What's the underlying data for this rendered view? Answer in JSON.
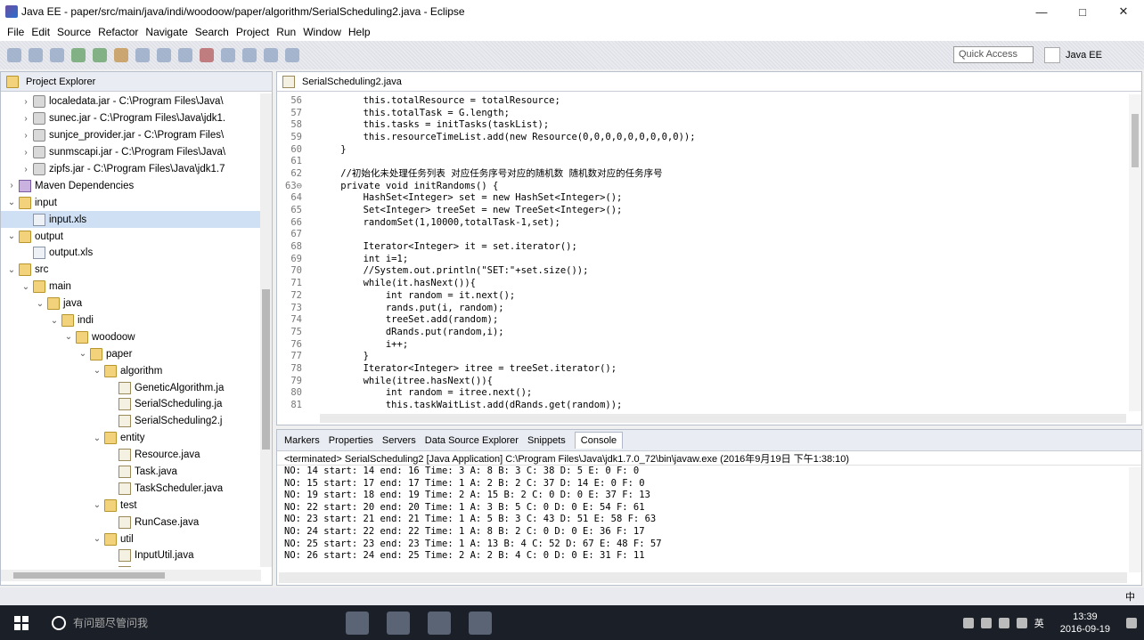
{
  "window": {
    "title": "Java EE - paper/src/main/java/indi/woodoow/paper/algorithm/SerialScheduling2.java - Eclipse",
    "minimize": "—",
    "maximize": "□",
    "close": "✕"
  },
  "menu": [
    "File",
    "Edit",
    "Source",
    "Refactor",
    "Navigate",
    "Search",
    "Project",
    "Run",
    "Window",
    "Help"
  ],
  "toolbar": {
    "quick_access": "Quick Access",
    "perspective": "Java EE"
  },
  "explorer": {
    "title": "Project Explorer",
    "rows": [
      {
        "indent": 3,
        "twisty": "›",
        "icon": "jar",
        "label": "localedata.jar - C:\\Program Files\\Java\\"
      },
      {
        "indent": 3,
        "twisty": "›",
        "icon": "jar",
        "label": "sunec.jar - C:\\Program Files\\Java\\jdk1."
      },
      {
        "indent": 3,
        "twisty": "›",
        "icon": "jar",
        "label": "sunjce_provider.jar - C:\\Program Files\\"
      },
      {
        "indent": 3,
        "twisty": "›",
        "icon": "jar",
        "label": "sunmscapi.jar - C:\\Program Files\\Java\\"
      },
      {
        "indent": 3,
        "twisty": "›",
        "icon": "jar",
        "label": "zipfs.jar - C:\\Program Files\\Java\\jdk1.7"
      },
      {
        "indent": 2,
        "twisty": "›",
        "icon": "lib",
        "label": "Maven Dependencies"
      },
      {
        "indent": 2,
        "twisty": "⌄",
        "icon": "folder",
        "label": "input"
      },
      {
        "indent": 3,
        "twisty": "",
        "icon": "file",
        "label": "input.xls",
        "selected": true
      },
      {
        "indent": 2,
        "twisty": "⌄",
        "icon": "folder",
        "label": "output"
      },
      {
        "indent": 3,
        "twisty": "",
        "icon": "file",
        "label": "output.xls"
      },
      {
        "indent": 2,
        "twisty": "⌄",
        "icon": "folder",
        "label": "src"
      },
      {
        "indent": 3,
        "twisty": "⌄",
        "icon": "folder",
        "label": "main"
      },
      {
        "indent": 4,
        "twisty": "⌄",
        "icon": "folder",
        "label": "java"
      },
      {
        "indent": 5,
        "twisty": "⌄",
        "icon": "folder",
        "label": "indi"
      },
      {
        "indent": 6,
        "twisty": "⌄",
        "icon": "folder",
        "label": "woodoow"
      },
      {
        "indent": 7,
        "twisty": "⌄",
        "icon": "folder",
        "label": "paper"
      },
      {
        "indent": 8,
        "twisty": "⌄",
        "icon": "folder",
        "label": "algorithm"
      },
      {
        "indent": 9,
        "twisty": "",
        "icon": "java",
        "label": "GeneticAlgorithm.ja"
      },
      {
        "indent": 9,
        "twisty": "",
        "icon": "java",
        "label": "SerialScheduling.ja"
      },
      {
        "indent": 9,
        "twisty": "",
        "icon": "java",
        "label": "SerialScheduling2.j"
      },
      {
        "indent": 8,
        "twisty": "⌄",
        "icon": "folder",
        "label": "entity"
      },
      {
        "indent": 9,
        "twisty": "",
        "icon": "java",
        "label": "Resource.java"
      },
      {
        "indent": 9,
        "twisty": "",
        "icon": "java",
        "label": "Task.java"
      },
      {
        "indent": 9,
        "twisty": "",
        "icon": "java",
        "label": "TaskScheduler.java"
      },
      {
        "indent": 8,
        "twisty": "⌄",
        "icon": "folder",
        "label": "test"
      },
      {
        "indent": 9,
        "twisty": "",
        "icon": "java",
        "label": "RunCase.java"
      },
      {
        "indent": 8,
        "twisty": "⌄",
        "icon": "folder",
        "label": "util"
      },
      {
        "indent": 9,
        "twisty": "",
        "icon": "java",
        "label": "InputUtil.java"
      },
      {
        "indent": 9,
        "twisty": "",
        "icon": "java",
        "label": "OutputUtil.java"
      }
    ]
  },
  "editor": {
    "tab": "SerialScheduling2.java",
    "lines": [
      {
        "n": "56",
        "t": "        this.totalResource = totalResource;"
      },
      {
        "n": "57",
        "t": "        this.totalTask = G.length;"
      },
      {
        "n": "58",
        "t": "        this.tasks = initTasks(taskList);"
      },
      {
        "n": "59",
        "t": "        this.resourceTimeList.add(new Resource(0,0,0,0,0,0,0,0,0));"
      },
      {
        "n": "60",
        "t": "    }"
      },
      {
        "n": "61",
        "t": ""
      },
      {
        "n": "62",
        "t": "    //初始化未处理任务列表 对应任务序号对应的随机数 随机数对应的任务序号"
      },
      {
        "n": "63⊖",
        "t": "    private void initRandoms() {"
      },
      {
        "n": "64",
        "t": "        HashSet<Integer> set = new HashSet<Integer>();"
      },
      {
        "n": "65",
        "t": "        Set<Integer> treeSet = new TreeSet<Integer>();"
      },
      {
        "n": "66",
        "t": "        randomSet(1,10000,totalTask-1,set);"
      },
      {
        "n": "67",
        "t": ""
      },
      {
        "n": "68",
        "t": "        Iterator<Integer> it = set.iterator();"
      },
      {
        "n": "69",
        "t": "        int i=1;"
      },
      {
        "n": "70",
        "t": "        //System.out.println(\"SET:\"+set.size());"
      },
      {
        "n": "71",
        "t": "        while(it.hasNext()){"
      },
      {
        "n": "72",
        "t": "            int random = it.next();"
      },
      {
        "n": "73",
        "t": "            rands.put(i, random);"
      },
      {
        "n": "74",
        "t": "            treeSet.add(random);"
      },
      {
        "n": "75",
        "t": "            dRands.put(random,i);"
      },
      {
        "n": "76",
        "t": "            i++;"
      },
      {
        "n": "77",
        "t": "        }"
      },
      {
        "n": "78",
        "t": "        Iterator<Integer> itree = treeSet.iterator();"
      },
      {
        "n": "79",
        "t": "        while(itree.hasNext()){"
      },
      {
        "n": "80",
        "t": "            int random = itree.next();"
      },
      {
        "n": "81",
        "t": "            this.taskWaitList.add(dRands.get(random));"
      }
    ]
  },
  "console": {
    "tabs": [
      "Markers",
      "Properties",
      "Servers",
      "Data Source Explorer",
      "Snippets",
      "Console"
    ],
    "active_tab": "Console",
    "terminated": "<terminated> SerialScheduling2 [Java Application] C:\\Program Files\\Java\\jdk1.7.0_72\\bin\\javaw.exe (2016年9月19日 下午1:38:10)",
    "lines": [
      "NO: 14 start: 14 end: 16 Time: 3 A: 8 B: 3 C: 38 D: 5 E: 0 F: 0",
      "NO: 15 start: 17 end: 17 Time: 1 A: 2 B: 2 C: 37 D: 14 E: 0 F: 0",
      "NO: 19 start: 18 end: 19 Time: 2 A: 15 B: 2 C: 0 D: 0 E: 37 F: 13",
      "NO: 22 start: 20 end: 20 Time: 1 A: 3 B: 5 C: 0 D: 0 E: 54 F: 61",
      "NO: 23 start: 21 end: 21 Time: 1 A: 5 B: 3 C: 43 D: 51 E: 58 F: 63",
      "NO: 24 start: 22 end: 22 Time: 1 A: 8 B: 2 C: 0 D: 0 E: 36 F: 17",
      "NO: 25 start: 23 end: 23 Time: 1 A: 13 B: 4 C: 52 D: 67 E: 48 F: 57",
      "NO: 26 start: 24 end: 25 Time: 2 A: 2 B: 4 C: 0 D: 0 E: 31 F: 11"
    ]
  },
  "taskbar": {
    "search_placeholder": "有问题尽管问我",
    "time": "13:39",
    "date": "2016-09-19",
    "ime": "中",
    "lang": "英"
  }
}
